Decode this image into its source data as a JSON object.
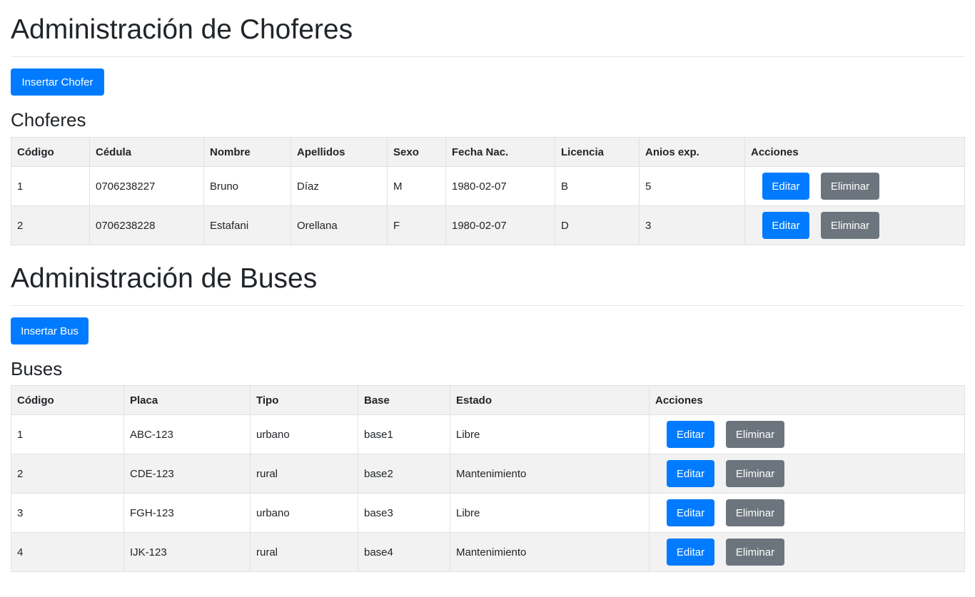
{
  "choferes": {
    "title": "Administración de Choferes",
    "insert_label": "Insertar Chofer",
    "subtitle": "Choferes",
    "columns": [
      "Código",
      "Cédula",
      "Nombre",
      "Apellidos",
      "Sexo",
      "Fecha Nac.",
      "Licencia",
      "Anios exp.",
      "Acciones"
    ],
    "rows": [
      [
        "1",
        "0706238227",
        "Bruno",
        "Díaz",
        "M",
        "1980-02-07",
        "B",
        "5"
      ],
      [
        "2",
        "0706238228",
        "Estafani",
        "Orellana",
        "F",
        "1980-02-07",
        "D",
        "3"
      ]
    ],
    "edit_label": "Editar",
    "delete_label": "Eliminar"
  },
  "buses": {
    "title": "Administración de Buses",
    "insert_label": "Insertar Bus",
    "subtitle": "Buses",
    "columns": [
      "Código",
      "Placa",
      "Tipo",
      "Base",
      "Estado",
      "Acciones"
    ],
    "rows": [
      [
        "1",
        "ABC-123",
        "urbano",
        "base1",
        "Libre"
      ],
      [
        "2",
        "CDE-123",
        "rural",
        "base2",
        "Mantenimiento"
      ],
      [
        "3",
        "FGH-123",
        "urbano",
        "base3",
        "Libre"
      ],
      [
        "4",
        "IJK-123",
        "rural",
        "base4",
        "Mantenimiento"
      ]
    ],
    "edit_label": "Editar",
    "delete_label": "Eliminar"
  },
  "colors": {
    "primary": "#007bff",
    "secondary": "#6c757d",
    "header_bg": "#f2f2f2",
    "border": "#dee2e6"
  }
}
